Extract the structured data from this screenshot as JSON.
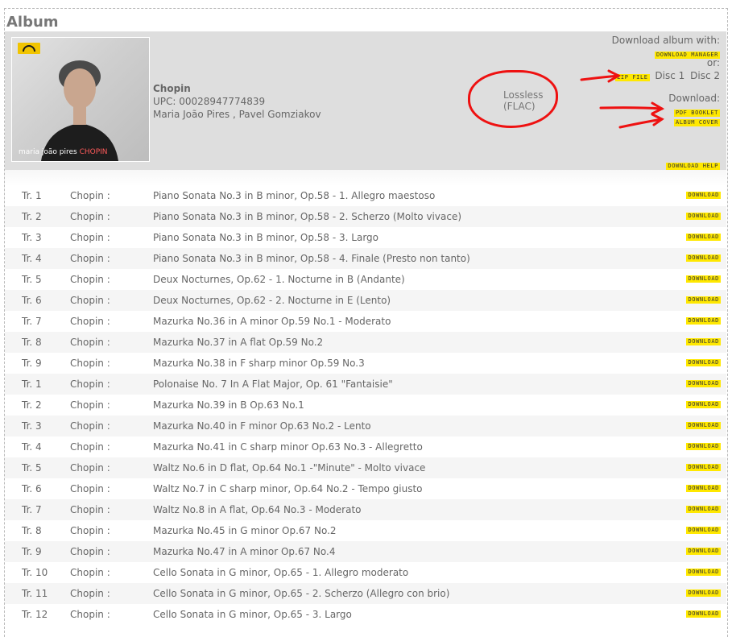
{
  "page": {
    "title": "Album"
  },
  "album": {
    "title": "Chopin",
    "upc": "UPC: 00028947774839",
    "artists": "Maria João Pires , Pavel Gomziakov",
    "cover": {
      "caption_artist": "maria joão pires",
      "caption_title": "CHOPIN"
    }
  },
  "annotation": {
    "line1": "Lossless",
    "line2": "(FLAC)",
    "color": "#ee1111"
  },
  "downloads": {
    "heading": "Download album with:",
    "manager_label": "DOWNLOAD MANAGER",
    "or_label": "or:",
    "zip_label": "ZIP FILE",
    "disc1": "Disc 1",
    "disc2": "Disc 2",
    "download_heading": "Download:",
    "booklet_label": "PDF BOOKLET",
    "cover_label": "ALBUM COVER",
    "help_label": "DOWNLOAD HELP",
    "badge_color": "#ffe800"
  },
  "tracks": [
    {
      "num": "Tr. 1",
      "composer": "Chopin :",
      "title": "Piano Sonata No.3 in B minor, Op.58 - 1. Allegro maestoso",
      "dl": "DOWNLOAD"
    },
    {
      "num": "Tr. 2",
      "composer": "Chopin :",
      "title": "Piano Sonata No.3 in B minor, Op.58 - 2. Scherzo (Molto vivace)",
      "dl": "DOWNLOAD"
    },
    {
      "num": "Tr. 3",
      "composer": "Chopin :",
      "title": "Piano Sonata No.3 in B minor, Op.58 - 3. Largo",
      "dl": "DOWNLOAD"
    },
    {
      "num": "Tr. 4",
      "composer": "Chopin :",
      "title": "Piano Sonata No.3 in B minor, Op.58 - 4. Finale (Presto non tanto)",
      "dl": "DOWNLOAD"
    },
    {
      "num": "Tr. 5",
      "composer": "Chopin :",
      "title": "Deux Nocturnes, Op.62 - 1. Nocturne in B (Andante)",
      "dl": "DOWNLOAD"
    },
    {
      "num": "Tr. 6",
      "composer": "Chopin :",
      "title": "Deux Nocturnes, Op.62 - 2. Nocturne in E (Lento)",
      "dl": "DOWNLOAD"
    },
    {
      "num": "Tr. 7",
      "composer": "Chopin :",
      "title": "Mazurka No.36 in A minor Op.59 No.1 - Moderato",
      "dl": "DOWNLOAD"
    },
    {
      "num": "Tr. 8",
      "composer": "Chopin :",
      "title": "Mazurka No.37 in A flat Op.59 No.2",
      "dl": "DOWNLOAD"
    },
    {
      "num": "Tr. 9",
      "composer": "Chopin :",
      "title": "Mazurka No.38 in F sharp minor Op.59 No.3",
      "dl": "DOWNLOAD"
    },
    {
      "num": "Tr. 1",
      "composer": "Chopin :",
      "title": "Polonaise No. 7 In A Flat Major, Op. 61 \"Fantaisie\"",
      "dl": "DOWNLOAD"
    },
    {
      "num": "Tr. 2",
      "composer": "Chopin :",
      "title": "Mazurka No.39 in B Op.63 No.1",
      "dl": "DOWNLOAD"
    },
    {
      "num": "Tr. 3",
      "composer": "Chopin :",
      "title": "Mazurka No.40 in F minor Op.63 No.2 - Lento",
      "dl": "DOWNLOAD"
    },
    {
      "num": "Tr. 4",
      "composer": "Chopin :",
      "title": "Mazurka No.41 in C sharp minor Op.63 No.3 - Allegretto",
      "dl": "DOWNLOAD"
    },
    {
      "num": "Tr. 5",
      "composer": "Chopin :",
      "title": "Waltz No.6 in D flat, Op.64 No.1 -\"Minute\" - Molto vivace",
      "dl": "DOWNLOAD"
    },
    {
      "num": "Tr. 6",
      "composer": "Chopin :",
      "title": "Waltz No.7 in C sharp minor, Op.64 No.2 - Tempo giusto",
      "dl": "DOWNLOAD"
    },
    {
      "num": "Tr. 7",
      "composer": "Chopin :",
      "title": "Waltz No.8 in A flat, Op.64 No.3 - Moderato",
      "dl": "DOWNLOAD"
    },
    {
      "num": "Tr. 8",
      "composer": "Chopin :",
      "title": "Mazurka No.45 in G minor Op.67 No.2",
      "dl": "DOWNLOAD"
    },
    {
      "num": "Tr. 9",
      "composer": "Chopin :",
      "title": "Mazurka No.47 in A minor Op.67 No.4",
      "dl": "DOWNLOAD"
    },
    {
      "num": "Tr. 10",
      "composer": "Chopin :",
      "title": "Cello Sonata in G minor, Op.65 - 1. Allegro moderato",
      "dl": "DOWNLOAD"
    },
    {
      "num": "Tr. 11",
      "composer": "Chopin :",
      "title": "Cello Sonata in G minor, Op.65 - 2. Scherzo (Allegro con brio)",
      "dl": "DOWNLOAD"
    },
    {
      "num": "Tr. 12",
      "composer": "Chopin :",
      "title": "Cello Sonata in G minor, Op.65 - 3. Largo",
      "dl": "DOWNLOAD"
    }
  ]
}
